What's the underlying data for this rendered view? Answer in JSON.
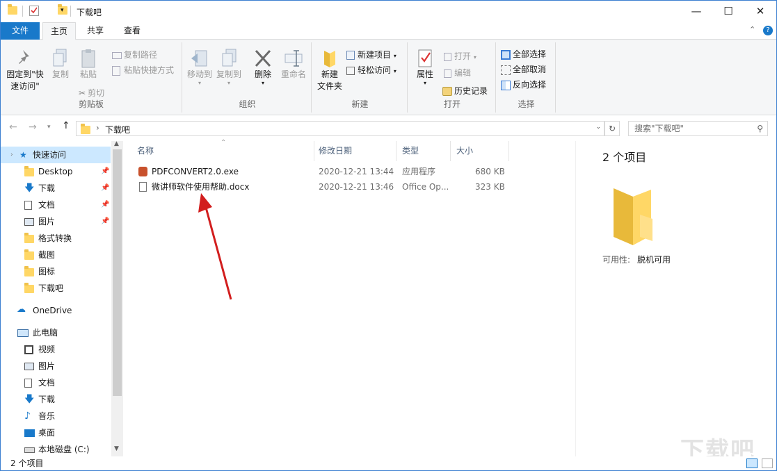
{
  "window": {
    "title": "下载吧",
    "controls": {
      "minimize": "—",
      "maximize": "☐",
      "close": "✕"
    }
  },
  "tabs": {
    "file": "文件",
    "home": "主页",
    "share": "共享",
    "view": "查看"
  },
  "ribbon": {
    "clipboard": {
      "label": "剪贴板",
      "pin": "固定到\"快速访问\"",
      "copy": "复制",
      "paste": "粘贴",
      "copy_path": "复制路径",
      "paste_shortcut": "粘贴快捷方式",
      "cut": "剪切"
    },
    "organize": {
      "label": "组织",
      "move_to": "移动到",
      "copy_to": "复制到",
      "delete": "删除",
      "rename": "重命名"
    },
    "new": {
      "label": "新建",
      "new_folder": "新建\n文件夹",
      "new_item": "新建项目",
      "easy_access": "轻松访问"
    },
    "open": {
      "label": "打开",
      "properties": "属性",
      "open": "打开",
      "edit": "编辑",
      "history": "历史记录"
    },
    "select": {
      "label": "选择",
      "select_all": "全部选择",
      "select_none": "全部取消",
      "invert": "反向选择"
    }
  },
  "address": {
    "path": "下载吧",
    "search_placeholder": "搜索\"下载吧\""
  },
  "nav": {
    "quick_access": "快速访问",
    "items": [
      {
        "label": "Desktop",
        "icon": "folder-icon",
        "pinned": true
      },
      {
        "label": "下载",
        "icon": "download-icon",
        "pinned": true
      },
      {
        "label": "文档",
        "icon": "document-icon",
        "pinned": true
      },
      {
        "label": "图片",
        "icon": "picture-icon",
        "pinned": true
      },
      {
        "label": "格式转换",
        "icon": "folder-icon",
        "pinned": false
      },
      {
        "label": "截图",
        "icon": "folder-icon",
        "pinned": false
      },
      {
        "label": "图标",
        "icon": "folder-icon",
        "pinned": false
      },
      {
        "label": "下载吧",
        "icon": "folder-icon",
        "pinned": false
      }
    ],
    "onedrive": "OneDrive",
    "this_pc": "此电脑",
    "pc_items": [
      {
        "label": "视频",
        "icon": "video-icon"
      },
      {
        "label": "图片",
        "icon": "picture-icon"
      },
      {
        "label": "文档",
        "icon": "document-icon"
      },
      {
        "label": "下载",
        "icon": "download-icon"
      },
      {
        "label": "音乐",
        "icon": "music-icon"
      },
      {
        "label": "桌面",
        "icon": "desktop-icon"
      },
      {
        "label": "本地磁盘 (C:)",
        "icon": "drive-icon"
      }
    ]
  },
  "columns": {
    "name": "名称",
    "date": "修改日期",
    "type": "类型",
    "size": "大小"
  },
  "files": [
    {
      "name": "PDFCONVERT2.0.exe",
      "date": "2020-12-21 13:44",
      "type": "应用程序",
      "size": "680 KB",
      "icon": "exe-icon"
    },
    {
      "name": "微讲师软件使用帮助.docx",
      "date": "2020-12-21 13:46",
      "type": "Office Op...",
      "size": "323 KB",
      "icon": "docx-icon"
    }
  ],
  "details": {
    "count": "2 个项目",
    "availability_label": "可用性:",
    "availability_value": "脱机可用"
  },
  "status": {
    "count": "2 个项目"
  },
  "watermark": "下载吧",
  "colors": {
    "accent": "#1979ca",
    "selection": "#cce8ff",
    "arrow": "#d21e1e",
    "folder": "#ffd766"
  }
}
